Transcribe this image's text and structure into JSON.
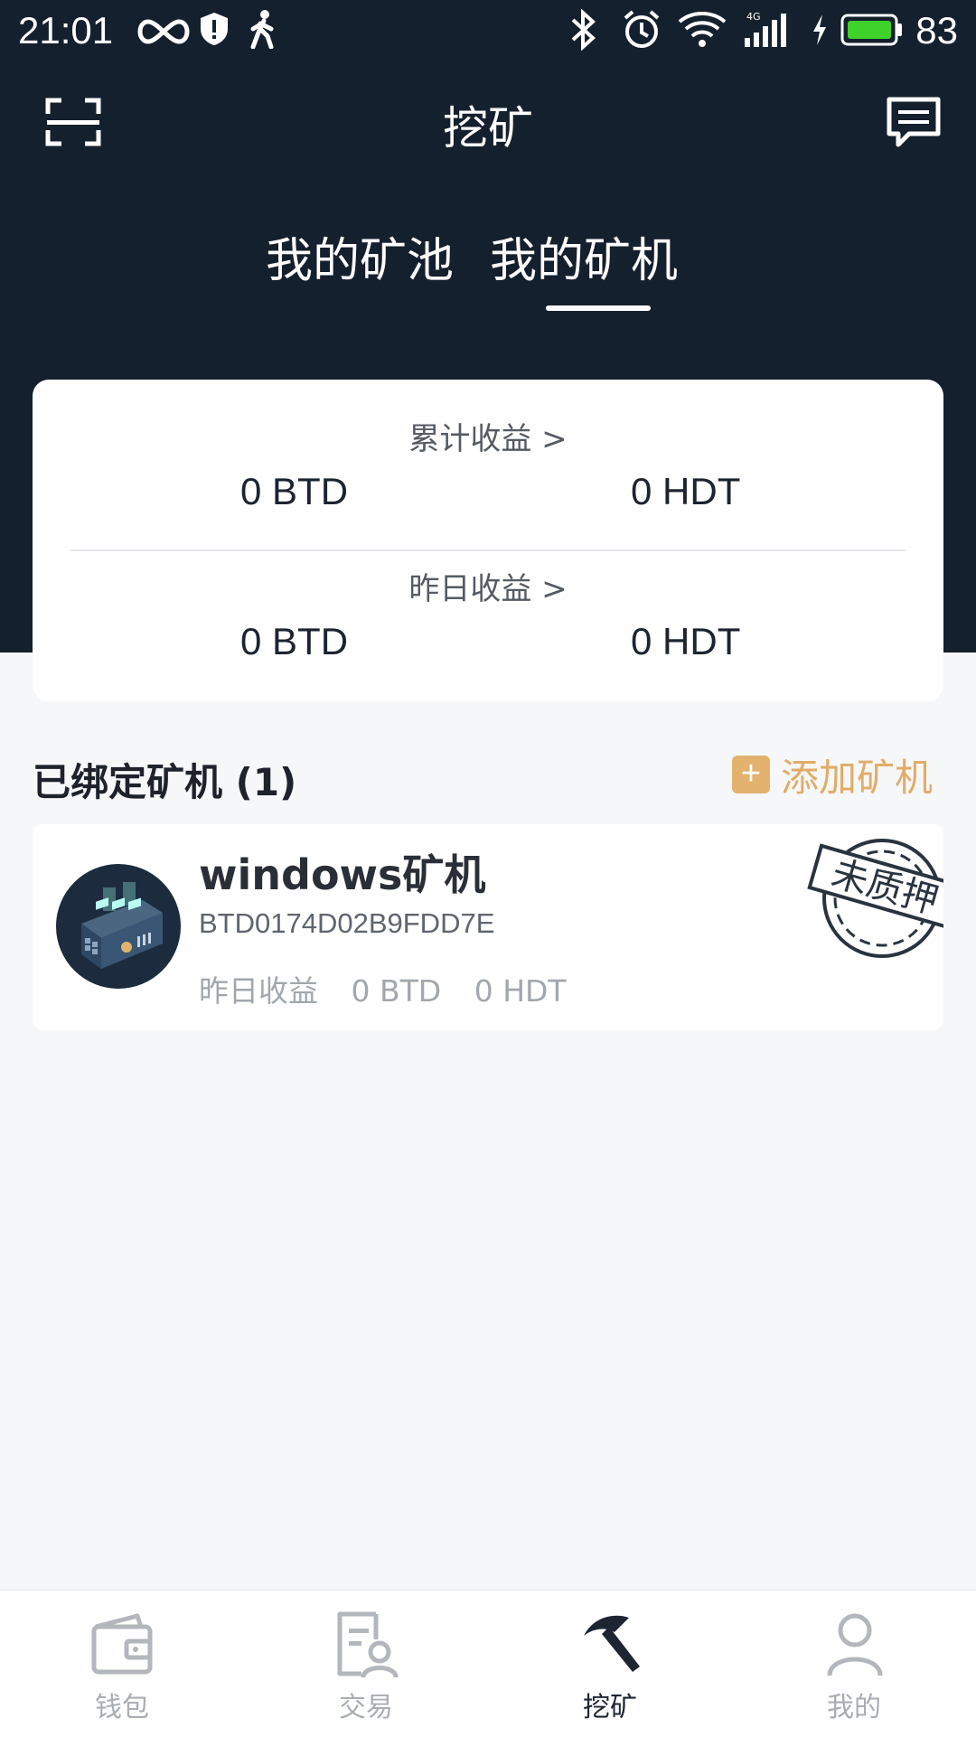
{
  "status_bar": {
    "time": "21:01",
    "battery": "83"
  },
  "header": {
    "title": "挖矿"
  },
  "tabs": [
    {
      "label": "我的矿池",
      "active": false
    },
    {
      "label": "我的矿机",
      "active": true
    }
  ],
  "earnings": {
    "total": {
      "label": "累计收益 >",
      "btd": "0 BTD",
      "hdt": "0 HDT"
    },
    "yesterday": {
      "label": "昨日收益 >",
      "btd": "0 BTD",
      "hdt": "0 HDT"
    }
  },
  "bound": {
    "title": "已绑定矿机 (1)",
    "add_label": "添加矿机",
    "add_symbol": "+"
  },
  "miners": [
    {
      "name": "windows矿机",
      "id": "BTD0174D02B9FDD7E",
      "yesterday_label": "昨日收益",
      "btd": "0 BTD",
      "hdt": "0 HDT",
      "stamp": "未质押"
    }
  ],
  "nav": [
    {
      "label": "钱包",
      "icon": "wallet-icon",
      "active": false
    },
    {
      "label": "交易",
      "icon": "trade-icon",
      "active": false
    },
    {
      "label": "挖矿",
      "icon": "pickaxe-icon",
      "active": true
    },
    {
      "label": "我的",
      "icon": "user-icon",
      "active": false
    }
  ],
  "colors": {
    "header_bg": "#15202e",
    "accent": "#e2b26e",
    "page_bg": "#f6f7f9"
  }
}
